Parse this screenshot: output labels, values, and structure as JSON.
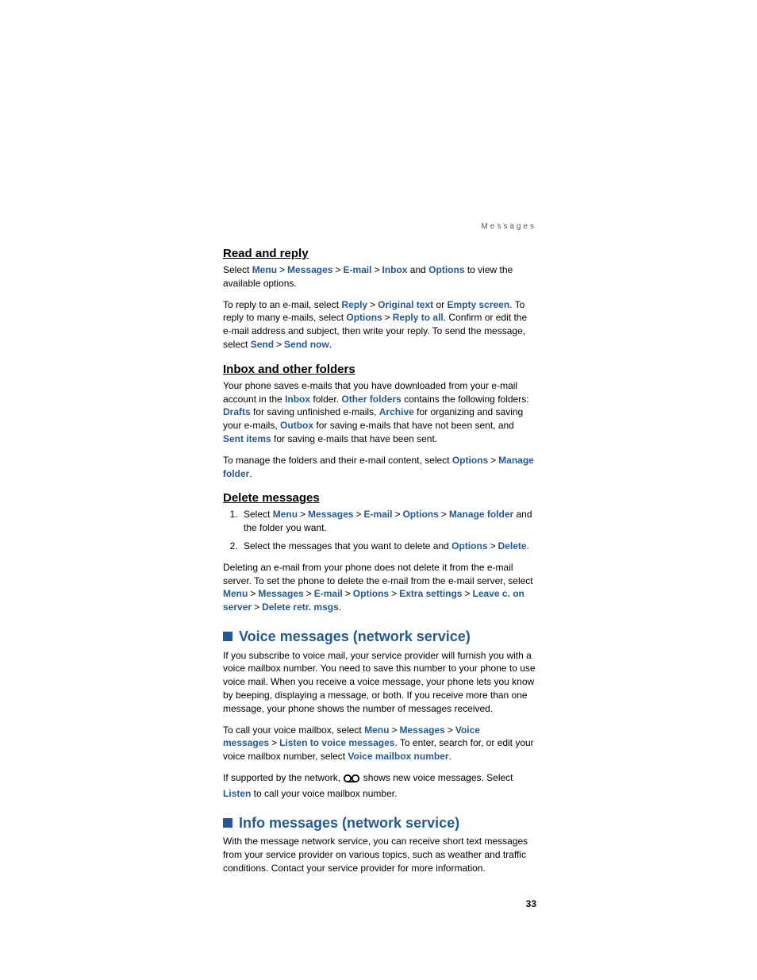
{
  "header": {
    "label": "Messages"
  },
  "sections": {
    "readReply": {
      "title": "Read and reply",
      "p1a": "Select ",
      "nav1_1": "Menu",
      "nav1_2": "Messages",
      "nav1_3": "E-mail",
      "nav1_4": "Inbox",
      "p1b": " and ",
      "nav1_5": "Options",
      "p1c": " to view the available options.",
      "p2a": "To reply to an e-mail, select ",
      "r1": "Reply",
      "r2": "Original text",
      "p2or": " or ",
      "r3": "Empty screen",
      "p2b": ". To reply to many e-mails, select ",
      "r4": "Options",
      "r5": "Reply to all",
      "p2c": ". Confirm or edit the e-mail address and subject, then write your reply. To send the message, select ",
      "r6": "Send",
      "r7": "Send now",
      "dot": "."
    },
    "inboxFolders": {
      "title": "Inbox and other folders",
      "p1a": "Your phone saves e-mails that you have downloaded from your e-mail account in the ",
      "f1": "Inbox",
      "p1b": " folder. ",
      "f2": "Other folders",
      "p1c": " contains the following folders: ",
      "f3": "Drafts",
      "p1d": " for saving unfinished e-mails, ",
      "f4": "Archive",
      "p1e": " for organizing and saving your e-mails, ",
      "f5": "Outbox",
      "p1f": " for saving e-mails that have not been sent, and ",
      "f6": "Sent items",
      "p1g": " for saving e-mails that have been sent.",
      "p2a": "To manage the folders and their e-mail content, select ",
      "m1": "Options",
      "m2": "Manage folder",
      "dot": "."
    },
    "delete": {
      "title": "Delete messages",
      "li1a": "Select ",
      "d1": "Menu",
      "d2": "Messages",
      "d3": "E-mail",
      "d4": "Options",
      "d5": "Manage folder",
      "li1b": " and the folder you want.",
      "li2a": "Select the messages that you want to delete and ",
      "d6": "Options",
      "d7": "Delete",
      "dot": ".",
      "p1a": "Deleting an e-mail from your phone does not delete it from the e-mail server. To set the phone to delete the e-mail from the e-mail server, select ",
      "e1": "Menu",
      "e2": "Messages",
      "e3": "E-mail",
      "e4": "Options",
      "e5": "Extra settings",
      "e6": "Leave c. on server",
      "e7": "Delete retr. msgs"
    },
    "voice": {
      "title": "Voice messages (network service)",
      "p1": "If you subscribe to voice mail, your service provider will furnish you with a voice mailbox number. You need to save this number to your phone to use voice mail. When you receive a voice message, your phone lets you know by beeping, displaying a message, or both. If you receive more than one message, your phone shows the number of messages received.",
      "p2a": "To call your voice mailbox, select ",
      "v1": "Menu",
      "v2": "Messages",
      "v3": "Voice messages",
      "v4": "Listen to voice messages",
      "p2b": ". To enter, search for, or edit your voice mailbox number, select ",
      "v5": "Voice mailbox number",
      "dot": ".",
      "p3a": "If supported by the network, ",
      "p3b": " shows new voice messages. Select ",
      "v6": "Listen",
      "p3c": " to call your voice mailbox number."
    },
    "info": {
      "title": "Info messages (network service)",
      "p1": "With the message network service, you can receive short text messages from your service provider on various topics, such as weather and traffic conditions. Contact your service provider for more information."
    }
  },
  "gt": ">",
  "pageNumber": "33"
}
